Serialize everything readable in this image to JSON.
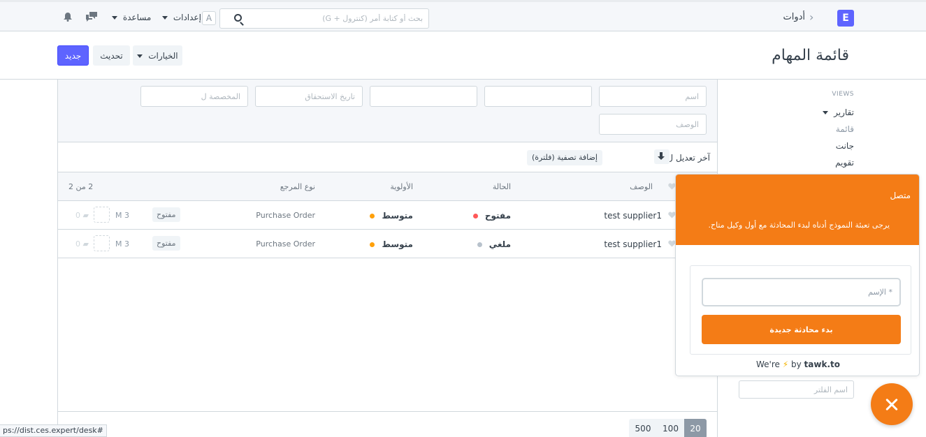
{
  "navbar": {
    "brand_letter": "E",
    "breadcrumb": "أدوات",
    "search_placeholder": "بحث أو كتابة أمر (كنترول + G)",
    "avatar_letter": "A",
    "settings_label": "إعدادات",
    "help_label": "مساعدة"
  },
  "page": {
    "title": "قائمة المهام",
    "new_label": "جديد",
    "refresh_label": "تحديث",
    "options_label": "الخيارات"
  },
  "sidebar": {
    "views_heading": "VIEWS",
    "reports": "تقارير",
    "list": "قائمة",
    "gantt": "جانت",
    "calendar": "تقويم",
    "filter_placeholder": "اسم الفلتر"
  },
  "filters": {
    "name_placeholder": "اسم",
    "empty1": "",
    "empty2": "",
    "due_date_placeholder": "تاريخ الاستحقاق",
    "assigned_placeholder": "المخصصة ل",
    "description_placeholder": "الوصف"
  },
  "sort": {
    "label": "آخر تعديل ل",
    "add_filter": "إضافة تصفية (فلترة)"
  },
  "columns": {
    "description": "الوصف",
    "status": "الحالة",
    "priority": "الأولوية",
    "reference_type": "نوع المرجع",
    "count": "2 من 2"
  },
  "rows": [
    {
      "subject": "test supplier1",
      "status": "مفتوح",
      "status_color": "#ff5858",
      "priority": "متوسط",
      "priority_color": "#ffa00a",
      "reference_type": "Purchase Order",
      "badge": "مفتوح",
      "modified": "3 M",
      "comments": "0"
    },
    {
      "subject": "test supplier1",
      "status": "ملغي",
      "status_color": "#b8c2cc",
      "priority": "متوسط",
      "priority_color": "#ffa00a",
      "reference_type": "Purchase Order",
      "badge": "مفتوح",
      "modified": "3 M",
      "comments": "0"
    }
  ],
  "pager": {
    "p20": "20",
    "p100": "100",
    "p500": "500"
  },
  "tawk": {
    "status": "متصل",
    "message": "يرجى تعبئة النموذج أدناه لبدء المحادثة مع أول وكيل متاح.",
    "name_placeholder": "* الإسم",
    "start_label": "بدء محادثة جديدة",
    "brand_prefix": "We're",
    "brand_by": "by",
    "brand_name": "tawk.to"
  },
  "status_url": "ps://dist.ces.expert/desk#"
}
